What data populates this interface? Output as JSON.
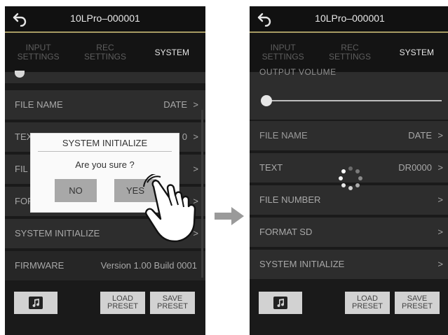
{
  "screens": {
    "left": {
      "title": "10LPro–000001",
      "tabs": [
        {
          "label": "INPUT\nSETTINGS"
        },
        {
          "label": "REC\nSETTINGS"
        },
        {
          "label": "SYSTEM"
        }
      ],
      "rows": [
        {
          "label": "FILE NAME",
          "value": "DATE"
        },
        {
          "label": "TEX",
          "value": "0"
        },
        {
          "label": "FIL",
          "value": ""
        },
        {
          "label": "FOR",
          "value": ""
        },
        {
          "label": "SYSTEM INITIALIZE",
          "value": ""
        },
        {
          "label": "FIRMWARE",
          "value": "Version 1.00 Build 0001"
        }
      ],
      "dialog": {
        "title": "SYSTEM INITIALIZE",
        "message": "Are you sure ?",
        "no": "NO",
        "yes": "YES"
      },
      "buttons": {
        "load": "LOAD\nPRESET",
        "save": "SAVE\nPRESET"
      }
    },
    "right": {
      "title": "10LPro–000001",
      "tabs": [
        {
          "label": "INPUT\nSETTINGS"
        },
        {
          "label": "REC\nSETTINGS"
        },
        {
          "label": "SYSTEM"
        }
      ],
      "slider_label": "OUTPUT VOLUME",
      "rows": [
        {
          "label": "FILE NAME",
          "value": "DATE"
        },
        {
          "label": "TEXT",
          "value": "DR0000"
        },
        {
          "label": "FILE NUMBER",
          "value": ""
        },
        {
          "label": "FORMAT SD",
          "value": ""
        },
        {
          "label": "SYSTEM INITIALIZE",
          "value": ""
        }
      ],
      "buttons": {
        "load": "LOAD\nPRESET",
        "save": "SAVE\nPRESET"
      }
    }
  },
  "icons": {
    "back": "back-arrow-icon",
    "music": "music-note-icon",
    "chevron": "chevron-right-icon",
    "arrow": "right-arrow-icon",
    "hand": "pointing-hand-icon",
    "spinner": "loading-spinner-icon"
  },
  "colors": {
    "accent_gold": "#a79b63",
    "background": "#1a1a1a",
    "row": "#2d2d2d"
  }
}
